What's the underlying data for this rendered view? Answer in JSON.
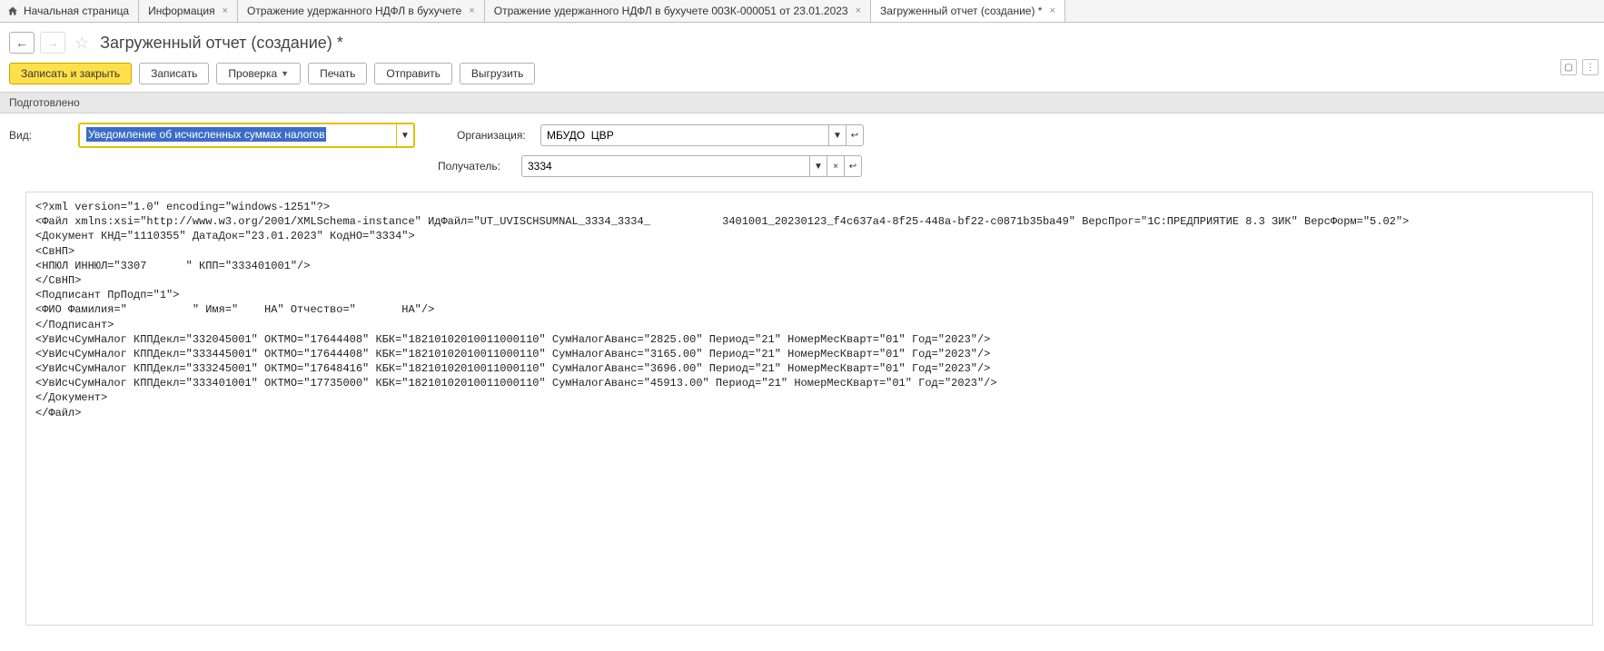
{
  "tabs": [
    {
      "label": "Начальная страница",
      "closable": false,
      "home": true
    },
    {
      "label": "Информация",
      "closable": true
    },
    {
      "label": "Отражение удержанного НДФЛ в бухучете",
      "closable": true
    },
    {
      "label": "Отражение удержанного НДФЛ в бухучете 00ЗК-000051 от 23.01.2023",
      "closable": true
    },
    {
      "label": "Загруженный отчет (создание) *",
      "closable": true,
      "active": true
    }
  ],
  "page_title": "Загруженный отчет (создание) *",
  "toolbar": {
    "save_close": "Записать и закрыть",
    "save": "Записать",
    "check": "Проверка",
    "print": "Печать",
    "send": "Отправить",
    "export": "Выгрузить"
  },
  "status": "Подготовлено",
  "form": {
    "vid_label": "Вид:",
    "vid_value": "Уведомление об исчисленных суммах налогов",
    "org_label": "Организация:",
    "org_value": "МБУДО  ЦВР",
    "recv_label": "Получатель:",
    "recv_value": "3334"
  },
  "xml_lines": [
    "<?xml version=\"1.0\" encoding=\"windows-1251\"?>",
    "<Файл xmlns:xsi=\"http://www.w3.org/2001/XMLSchema-instance\" ИдФайл=\"UT_UVISCHSUMNAL_3334_3334_           3401001_20230123_f4c637a4-8f25-448a-bf22-c0871b35ba49\" ВерсПрог=\"1C:ПРЕДПРИЯТИЕ 8.3 ЗИК\" ВерсФорм=\"5.02\">",
    "<Документ КНД=\"1110355\" ДатаДок=\"23.01.2023\" КодНО=\"3334\">",
    "<СвНП>",
    "<НПЮЛ ИННЮЛ=\"3307      \" КПП=\"333401001\"/>",
    "</СвНП>",
    "<Подписант ПрПодп=\"1\">",
    "<ФИО Фамилия=\"          \" Имя=\"    НА\" Отчество=\"       НА\"/>",
    "</Подписант>",
    "<УвИсчСумНалог КППДекл=\"332045001\" ОКТМО=\"17644408\" КБК=\"18210102010011000110\" СумНалогАванс=\"2825.00\" Период=\"21\" НомерМесКварт=\"01\" Год=\"2023\"/>",
    "<УвИсчСумНалог КППДекл=\"333445001\" ОКТМО=\"17644408\" КБК=\"18210102010011000110\" СумНалогАванс=\"3165.00\" Период=\"21\" НомерМесКварт=\"01\" Год=\"2023\"/>",
    "<УвИсчСумНалог КППДекл=\"333245001\" ОКТМО=\"17648416\" КБК=\"18210102010011000110\" СумНалогАванс=\"3696.00\" Период=\"21\" НомерМесКварт=\"01\" Год=\"2023\"/>",
    "<УвИсчСумНалог КППДекл=\"333401001\" ОКТМО=\"17735000\" КБК=\"18210102010011000110\" СумНалогАванс=\"45913.00\" Период=\"21\" НомерМесКварт=\"01\" Год=\"2023\"/>",
    "</Документ>",
    "</Файл>"
  ]
}
